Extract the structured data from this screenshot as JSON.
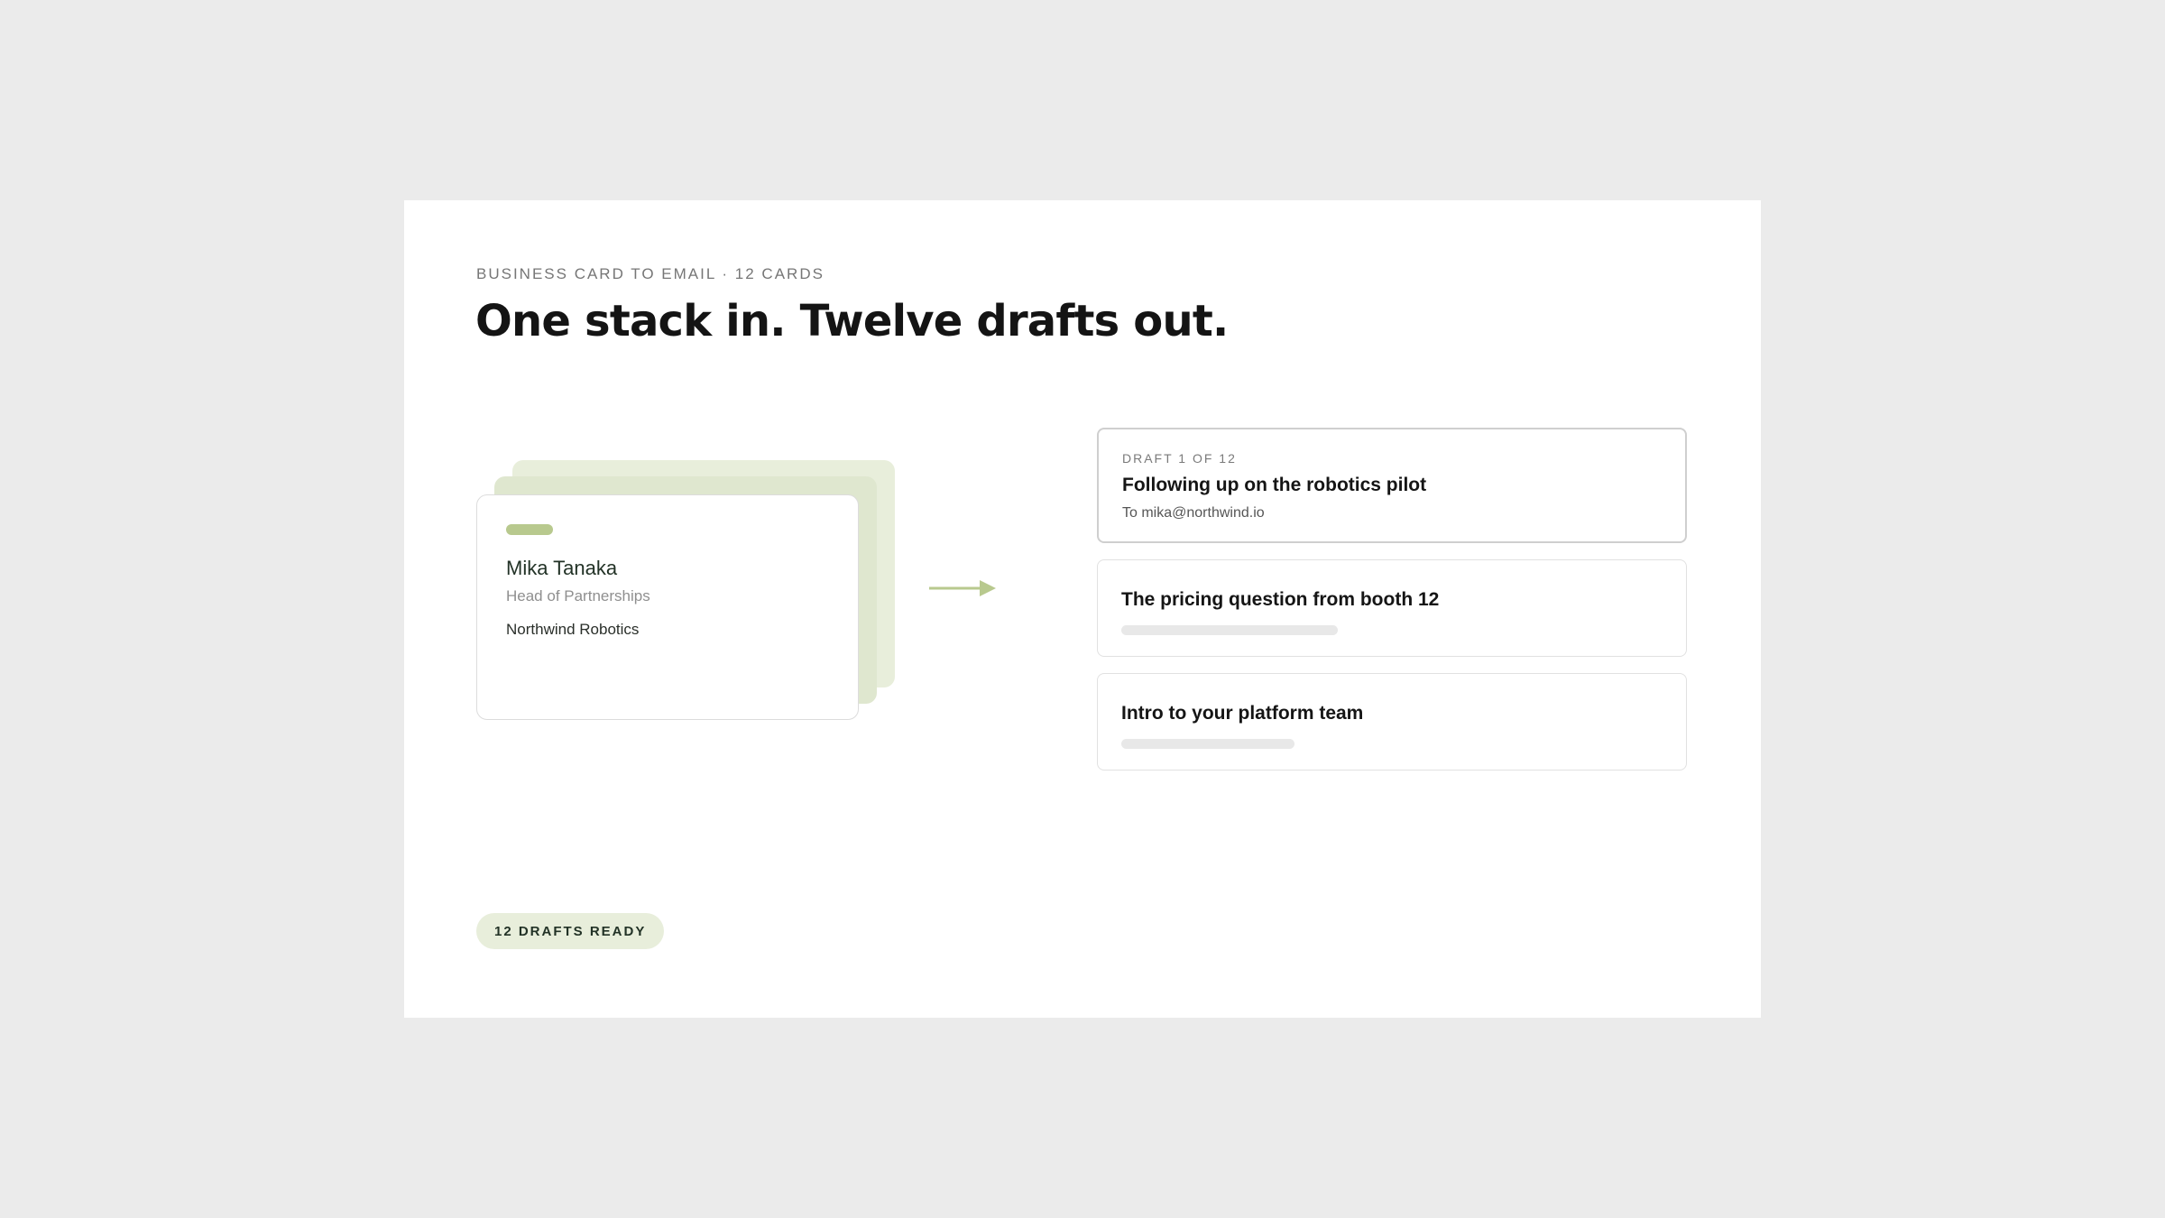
{
  "header": {
    "eyebrow": "BUSINESS CARD TO EMAIL · 12 CARDS",
    "title": "One stack in. Twelve drafts out."
  },
  "card": {
    "name": "Mika Tanaka",
    "role": "Head of Partnerships",
    "company": "Northwind Robotics"
  },
  "icons": {
    "arrow": "arrow-right-icon"
  },
  "drafts": [
    {
      "label": "DRAFT 1 OF 12",
      "subject": "Following up on the robotics pilot",
      "to": "To mika@northwind.io"
    },
    {
      "subject": "The pricing question from booth 12"
    },
    {
      "subject": "Intro to your platform team"
    }
  ],
  "status": {
    "label": "12 DRAFTS READY"
  },
  "colors": {
    "accent": "#b8c98e",
    "accent_light": "#e8eedb",
    "background": "#ebebeb",
    "panel": "#ffffff",
    "text": "#141414"
  }
}
